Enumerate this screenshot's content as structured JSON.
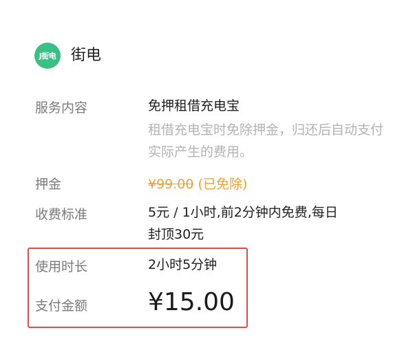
{
  "brand": {
    "logo_text": "J街电",
    "name": "街电"
  },
  "details": {
    "service": {
      "label": "服务内容",
      "title": "免押租借充电宝",
      "description": "租借充电宝时免除押金，归还后自动支付实际产生的费用。"
    },
    "deposit": {
      "label": "押金",
      "price": "¥99.00",
      "status": "(已免除)"
    },
    "fee_standard": {
      "label": "收费标准",
      "line1": "5元 / 1小时,前2分钟内免费,每日",
      "line2": "封顶30元"
    },
    "usage_duration": {
      "label": "使用时长",
      "value": "2小时5分钟"
    },
    "payment_amount": {
      "label": "支付金额",
      "value": "¥15.00"
    }
  },
  "colors": {
    "brand_green": "#3bbf86",
    "deposit_orange": "#f0a033",
    "highlight_red": "#e84a43",
    "label_gray": "#7b7b7b",
    "description_gray": "#b3b3b3"
  }
}
